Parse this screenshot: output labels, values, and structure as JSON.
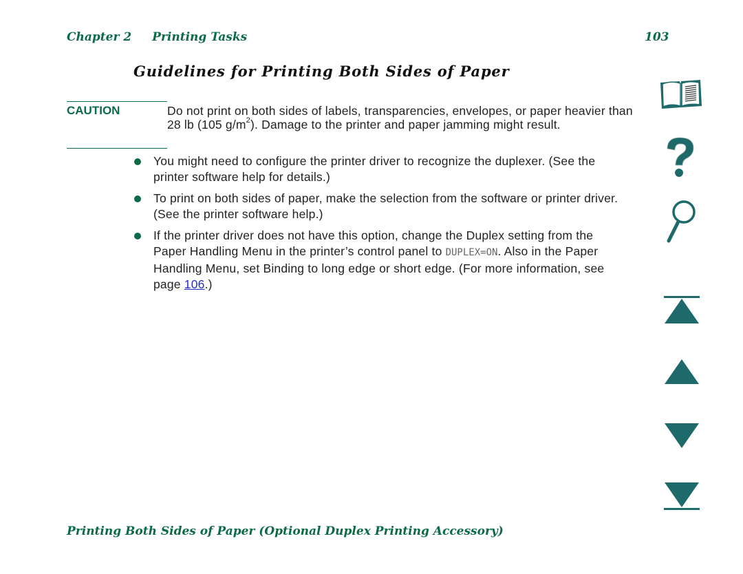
{
  "header": {
    "chapter": "Chapter 2",
    "section": "Printing Tasks",
    "page_number": "103"
  },
  "title": "Guidelines for Printing Both Sides of Paper",
  "caution": {
    "label": "CAUTION",
    "text_before_sup": "Do not print on both sides of labels, transparencies, envelopes, or paper heavier than 28 lb (105 g/m",
    "sup": "2",
    "text_after_sup": "). Damage to the printer and paper jamming might result."
  },
  "bullets": [
    {
      "text": "You might need to configure the printer driver to recognize the duplexer. (See the printer software help for details.)"
    },
    {
      "text": "To print on both sides of paper, make the selection from the software or printer driver. (See the printer software help.)"
    },
    {
      "text_before_setting": "If the printer driver does not have this option, change the Duplex setting from the Paper Handling Menu in the printer’s control panel to ",
      "setting": "DUPLEX=ON",
      "text_after_setting": ". Also in the Paper Handling Menu, set Binding to long edge or short edge. (For more information, see page ",
      "link": "106",
      "text_end": ".)"
    }
  ],
  "footer": "Printing Both Sides of Paper (Optional Duplex Printing Accessory)",
  "nav_icons": [
    {
      "name": "contents",
      "icon": "book-icon"
    },
    {
      "name": "help",
      "icon": "question-mark-icon"
    },
    {
      "name": "index",
      "icon": "magnifier-icon"
    },
    {
      "name": "first-page",
      "icon": "first-page-icon"
    },
    {
      "name": "previous-page",
      "icon": "previous-page-icon"
    },
    {
      "name": "next-page",
      "icon": "next-page-icon"
    },
    {
      "name": "last-page",
      "icon": "last-page-icon"
    }
  ],
  "colors": {
    "accent": "#0b6b47",
    "icon_teal": "#1e6a6a",
    "link": "#1f2fd0"
  }
}
